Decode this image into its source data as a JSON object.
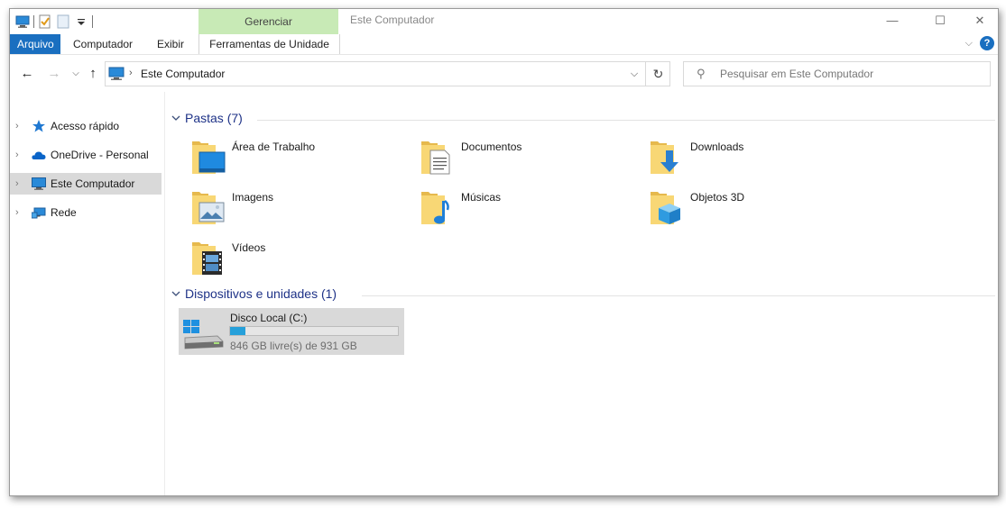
{
  "titlebar": {
    "manage_tab": "Gerenciar",
    "window_title": "Este Computador",
    "minimize": "—",
    "maximize": "☐",
    "close": "✕"
  },
  "ribbon": {
    "tabs": [
      {
        "label": "Arquivo",
        "active": true
      },
      {
        "label": "Computador"
      },
      {
        "label": "Exibir"
      },
      {
        "label": "Ferramentas de Unidade"
      }
    ],
    "collapse_chevron": "⌵",
    "help": "?"
  },
  "address": {
    "path": "Este Computador",
    "separator": "›",
    "dropdown": "⌵",
    "refresh": "↻",
    "back": "←",
    "forward": "→",
    "recent": "⌵",
    "up": "↑"
  },
  "search": {
    "placeholder": "Pesquisar em Este Computador"
  },
  "nav": {
    "items": [
      {
        "label": "Acesso rápido",
        "icon": "star-icon"
      },
      {
        "label": "OneDrive - Personal",
        "icon": "cloud-icon"
      },
      {
        "label": "Este Computador",
        "icon": "computer-icon",
        "selected": true
      },
      {
        "label": "Rede",
        "icon": "network-icon"
      }
    ],
    "expand_glyph": "›"
  },
  "folders_group": {
    "title": "Pastas (7)",
    "items": [
      {
        "label": "Área de Trabalho",
        "icon": "desktop-folder-icon"
      },
      {
        "label": "Documentos",
        "icon": "documents-folder-icon"
      },
      {
        "label": "Downloads",
        "icon": "downloads-folder-icon"
      },
      {
        "label": "Imagens",
        "icon": "pictures-folder-icon"
      },
      {
        "label": "Músicas",
        "icon": "music-folder-icon"
      },
      {
        "label": "Objetos 3D",
        "icon": "3d-objects-folder-icon"
      },
      {
        "label": "Vídeos",
        "icon": "videos-folder-icon"
      }
    ]
  },
  "devices_group": {
    "title": "Dispositivos e unidades (1)",
    "drives": [
      {
        "label": "Disco Local (C:)",
        "free_text": "846 GB livre(s) de 931 GB",
        "used_fraction": 0.091,
        "icon": "windows-drive-icon"
      }
    ]
  },
  "colors": {
    "accent": "#1a6fc0",
    "manage_tab_bg": "#c8eab6",
    "group_title": "#1e3287",
    "drive_bar": "#26a0da",
    "folder_yellow": "#f8d775"
  }
}
